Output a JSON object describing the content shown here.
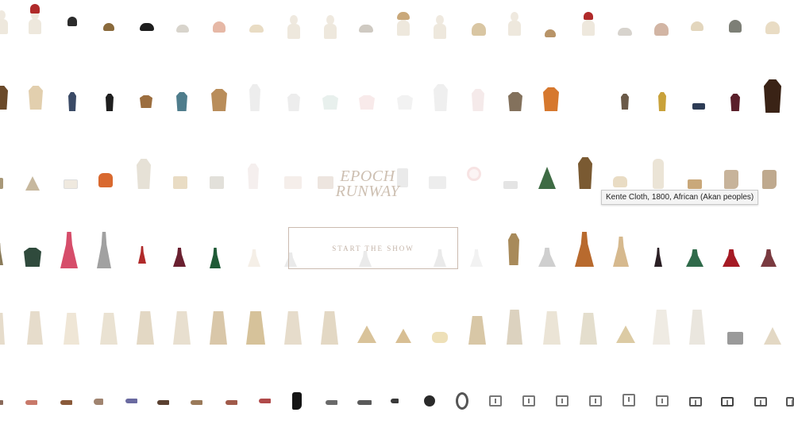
{
  "app": {
    "logo_line1": "EPOCH",
    "logo_line2": "RUNWAY",
    "start_button_label": "START THE SHOW"
  },
  "tooltip": {
    "text": "Kente Cloth, 1800, African (Akan peoples)"
  },
  "palette": {
    "logo": "#cdbfb1",
    "button_border": "#cbbbb0",
    "cream": "#e9dcc4",
    "tan": "#c9a87a",
    "dark": "#2b2b2b",
    "red": "#b02a2a",
    "orange": "#d6782e",
    "green": "#3e6b44",
    "pink": "#d64d6a"
  },
  "rows": [
    {
      "name": "hats-row",
      "category": "headwear"
    },
    {
      "name": "tops-row",
      "category": "tops"
    },
    {
      "name": "accessories-row",
      "category": "accessories"
    },
    {
      "name": "dresses-row",
      "category": "dresses"
    },
    {
      "name": "skirts-row",
      "category": "skirts"
    },
    {
      "name": "shoes-row",
      "category": "shoes-and-buckles"
    }
  ]
}
